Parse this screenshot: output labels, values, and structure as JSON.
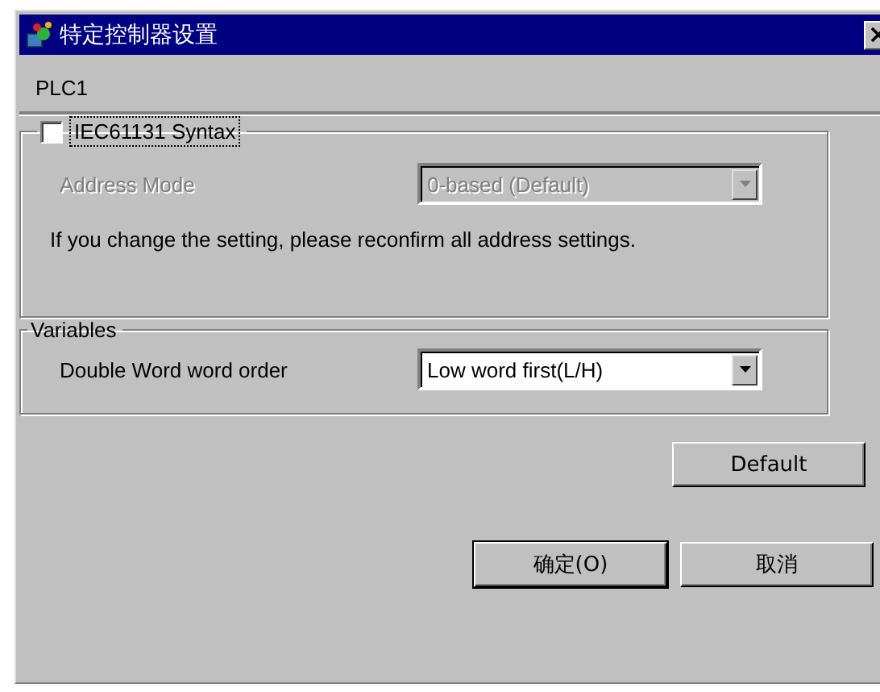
{
  "window": {
    "title": "特定控制器设置"
  },
  "device": "PLC1",
  "syntax_group": {
    "checkbox": {
      "label": "IEC61131 Syntax",
      "checked": false,
      "focused": true
    },
    "address_mode": {
      "label": "Address Mode",
      "value": "0-based (Default)",
      "disabled": true
    },
    "note": "If you change the setting, please reconfirm all address settings."
  },
  "variables_group": {
    "title": "Variables",
    "word_order": {
      "label": "Double Word word order",
      "value": "Low word first(L/H)",
      "disabled": false
    }
  },
  "default_button": "Default",
  "buttons": [
    {
      "label": "确定(O)"
    },
    {
      "label": "取消"
    }
  ]
}
